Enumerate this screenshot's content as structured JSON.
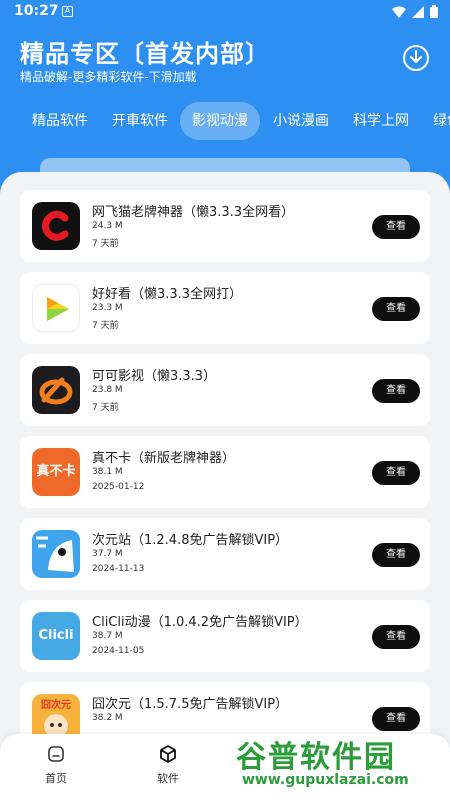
{
  "status_bar": {
    "time": "10:27",
    "notification_icon": "a-box-icon",
    "icons": [
      "wifi-icon",
      "signal-icon",
      "battery-icon"
    ]
  },
  "header": {
    "title": "精品专区〔首发内部〕",
    "subtitle": "精品破解-更多精彩软件-下滑加载",
    "download_icon": "download-icon"
  },
  "tabs": [
    {
      "label": "精品软件",
      "active": false
    },
    {
      "label": "开車软件",
      "active": false
    },
    {
      "label": "影视动漫",
      "active": true
    },
    {
      "label": "小说漫画",
      "active": false
    },
    {
      "label": "科学上网",
      "active": false
    },
    {
      "label": "绿色",
      "active": false
    }
  ],
  "apps": [
    {
      "name": "网飞猫老牌神器（懒3.3.3全网看）",
      "size": "24.3 M",
      "date": "7 天前",
      "icon": "netflix-cat-icon",
      "button": "查看"
    },
    {
      "name": "好好看（懒3.3.3全网打）",
      "size": "23.3 M",
      "date": "7 天前",
      "icon": "haohaokan-icon",
      "button": "查看"
    },
    {
      "name": "可可影视（懒3.3.3）",
      "size": "23.8 M",
      "date": "7 天前",
      "icon": "keke-icon",
      "button": "查看"
    },
    {
      "name": "真不卡（新版老牌神器）",
      "size": "38.1 M",
      "date": "2025-01-12",
      "icon": "zhenbuka-icon",
      "icon_text": "真不卡",
      "button": "查看"
    },
    {
      "name": "次元站（1.2.4.8免广告解锁VIP）",
      "size": "37.7 M",
      "date": "2024-11-13",
      "icon": "ciyuanzhan-icon",
      "button": "查看"
    },
    {
      "name": "CliCli动漫（1.0.4.2免广告解锁VIP）",
      "size": "38.7 M",
      "date": "2024-11-05",
      "icon": "clicli-icon",
      "icon_text": "Clicli",
      "button": "查看"
    },
    {
      "name": "囧次元（1.5.7.5免广告解锁VIP）",
      "size": "38.2 M",
      "date": "",
      "icon": "jiongciyuan-icon",
      "icon_text": "囧次元",
      "button": "查看"
    }
  ],
  "bottom_nav": [
    {
      "label": "首页",
      "icon": "home-icon"
    },
    {
      "label": "软件",
      "icon": "cube-icon"
    }
  ],
  "watermark": {
    "title": "谷普软件园",
    "url": "www.gupuxlazai.com"
  },
  "colors": {
    "header_blue": "#2d8ff2",
    "sheet_bg": "#f2f3f5",
    "button_black": "#0e0e0e",
    "watermark_green": "#2a9d3a"
  }
}
